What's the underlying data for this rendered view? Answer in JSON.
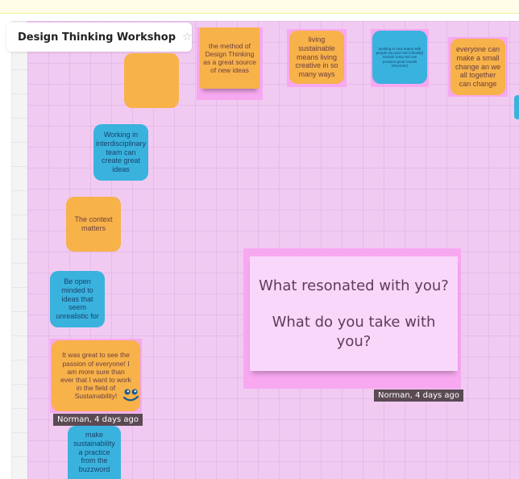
{
  "board": {
    "title": "Design Thinking Workshop",
    "star_icon": "star-icon"
  },
  "colors": {
    "frame": "#f1caf2",
    "orange_note": "#f7b24a",
    "blue_note": "#3ab2de",
    "tag_bg": "#5b4a54"
  },
  "notes": {
    "method": "the method of Design Thinking as a great source of new ideas",
    "living": "living sustainable means living creative in so many ways",
    "working_new_teams": "working in new teams with people you just met (virtually) sounds scary but can produce great results (#Iceriver)",
    "everyone_change": "everyone can make a small change an we all together can change",
    "interdisciplinary": "Working in interdisciplinary team can create great ideas",
    "context": "The context matters",
    "open_minded": "Be open minded to ideas that seem unrealistic for",
    "passion": "It was great to see the passion of everyone! I am more sure than ever that I want to work in the field of Sustainability!",
    "make_practice": "make sustainability a practice from the buzzword",
    "empty_orange": ""
  },
  "prompt": {
    "line1": "What resonated with you?",
    "line2": "What do you take with you?"
  },
  "comments": {
    "left": "Norman, 4 days ago",
    "right": "Norman, 4 days ago"
  }
}
